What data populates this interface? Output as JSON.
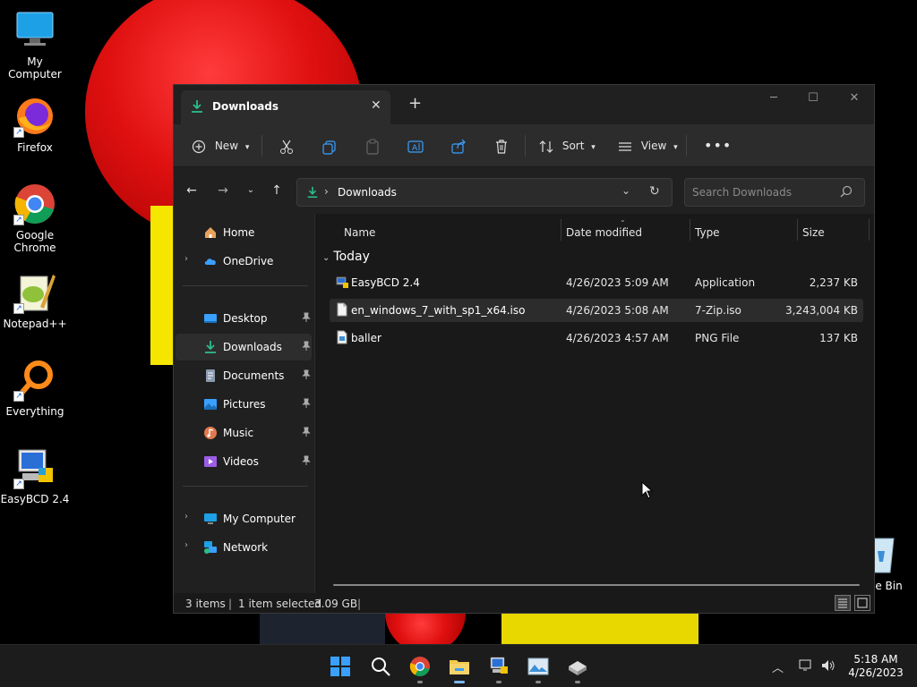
{
  "desktop": {
    "icons": [
      {
        "label": "My Computer"
      },
      {
        "label": "Firefox"
      },
      {
        "label": "Google\nChrome"
      },
      {
        "label": "Notepad++"
      },
      {
        "label": "Everything"
      },
      {
        "label": "EasyBCD 2.4"
      }
    ],
    "recycle_label": "le Bin"
  },
  "window": {
    "tab_title": "Downloads",
    "toolbar": {
      "new_label": "New",
      "sort_label": "Sort",
      "view_label": "View"
    },
    "address": {
      "path": "Downloads",
      "search_placeholder": "Search Downloads"
    },
    "sidebar": {
      "items": [
        {
          "label": "Home",
          "icon": "home-icon"
        },
        {
          "label": "OneDrive",
          "icon": "cloud-icon"
        },
        {
          "label": "Desktop",
          "icon": "desktop-icon"
        },
        {
          "label": "Downloads",
          "icon": "download-icon"
        },
        {
          "label": "Documents",
          "icon": "document-icon"
        },
        {
          "label": "Pictures",
          "icon": "pictures-icon"
        },
        {
          "label": "Music",
          "icon": "music-icon"
        },
        {
          "label": "Videos",
          "icon": "video-icon"
        },
        {
          "label": "My Computer",
          "icon": "computer-icon"
        },
        {
          "label": "Network",
          "icon": "network-icon"
        }
      ]
    },
    "columns": {
      "name": "Name",
      "date": "Date modified",
      "type": "Type",
      "size": "Size"
    },
    "group": "Today",
    "files": [
      {
        "name": "EasyBCD 2.4",
        "date": "4/26/2023 5:09 AM",
        "type": "Application",
        "size": "2,237 KB"
      },
      {
        "name": "en_windows_7_with_sp1_x64.iso",
        "date": "4/26/2023 5:08 AM",
        "type": "7-Zip.iso",
        "size": "3,243,004 KB"
      },
      {
        "name": "baller",
        "date": "4/26/2023 4:57 AM",
        "type": "PNG File",
        "size": "137 KB"
      }
    ],
    "status": {
      "count": "3 items",
      "selected": "1 item selected",
      "selected_size": "3.09 GB"
    }
  },
  "taskbar": {
    "time": "5:18 AM",
    "date": "4/26/2023"
  },
  "colors": {
    "accent_green": "#2dbd8a",
    "folder_yellow": "#f2c94c",
    "blue": "#3aa0ff"
  }
}
